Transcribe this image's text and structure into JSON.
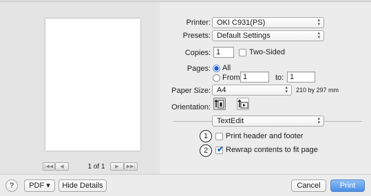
{
  "preview": {
    "page_label": "1 of 1"
  },
  "printer": {
    "label": "Printer:",
    "value": "OKI C931(PS)"
  },
  "presets": {
    "label": "Presets:",
    "value": "Default Settings"
  },
  "copies": {
    "label": "Copies:",
    "value": "1",
    "two_sided_label": "Two-Sided",
    "two_sided_checked": false
  },
  "pages": {
    "label": "Pages:",
    "all_label": "All",
    "from_label": "From:",
    "from_value": "1",
    "to_label": "to:",
    "to_value": "1",
    "selected": "All"
  },
  "paper_size": {
    "label": "Paper Size:",
    "value": "A4",
    "dimensions": "210 by 297 mm"
  },
  "orientation": {
    "label": "Orientation:",
    "selected": "portrait"
  },
  "section": {
    "value": "TextEdit"
  },
  "options": {
    "print_header_label": "Print header and footer",
    "print_header_checked": false,
    "rewrap_label": "Rewrap contents to fit page",
    "rewrap_checked": true
  },
  "callouts": {
    "one": "①",
    "two": "②"
  },
  "bottom": {
    "help": "?",
    "pdf_label": "PDF ▾",
    "hide_details": "Hide Details",
    "cancel": "Cancel",
    "print": "Print"
  },
  "colors": {
    "accent": "#4a8ee8",
    "checkmark": "#1f5fc7"
  }
}
